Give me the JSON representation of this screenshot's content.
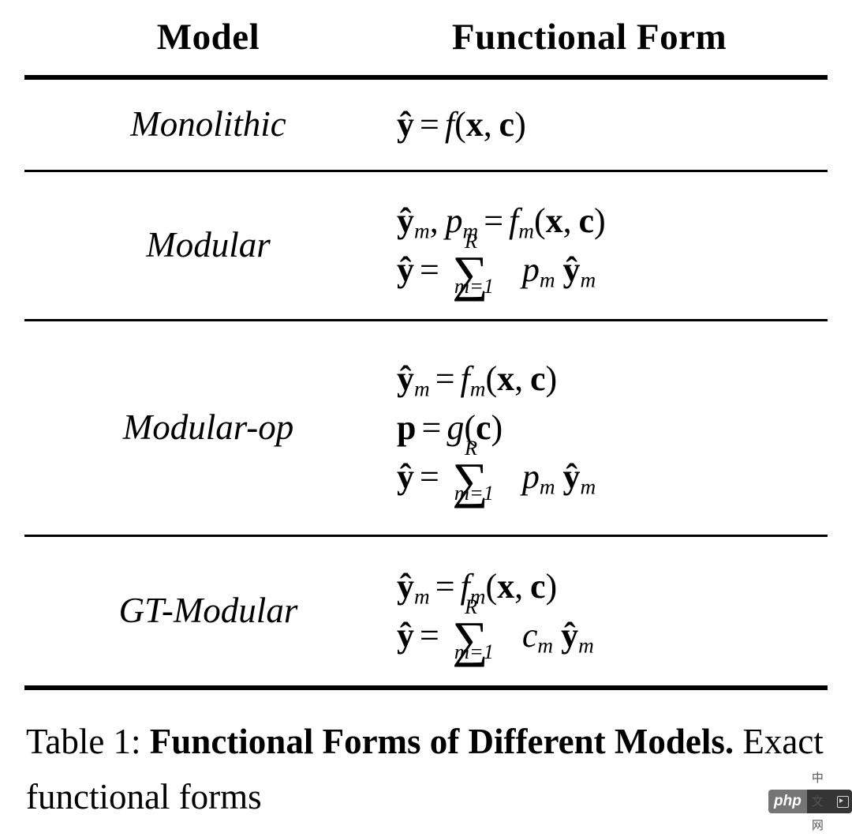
{
  "table": {
    "caption_number": "Table 1:",
    "caption_bold": "Functional Forms of Different Models.",
    "caption_rest": "Exact functional forms",
    "headers": {
      "model": "Model",
      "functional_form": "Functional Form"
    },
    "rows": [
      {
        "model": "Monolithic",
        "formula_lines": [
          "ŷ = f(x, c)"
        ]
      },
      {
        "model": "Modular",
        "formula_lines": [
          "ŷ_m, p_m = f_m(x, c)",
          "ŷ = Σ_{m=1}^{R} p_m ŷ_m"
        ]
      },
      {
        "model": "Modular-op",
        "formula_lines": [
          "ŷ_m = f_m(x, c)",
          "p = g(c)",
          "ŷ = Σ_{m=1}^{R} p_m ŷ_m"
        ]
      },
      {
        "model": "GT-Modular",
        "formula_lines": [
          "ŷ_m = f_m(x, c)",
          "ŷ = Σ_{m=1}^{R} c_m ŷ_m"
        ]
      }
    ],
    "symbols": {
      "y_hat": "ŷ",
      "equals": "=",
      "sum": "∑",
      "sum_upper": "R",
      "sum_lower": "m=1",
      "subscript_m": "m",
      "f": "f",
      "g": "g",
      "p": "p",
      "c": "c",
      "x": "x",
      "comma": ",",
      "open_paren": "(",
      "close_paren": ")"
    }
  },
  "watermark": {
    "php_label": "php",
    "cn_label": "中文网",
    "icon": "video-icon"
  },
  "colors": {
    "text": "#000000",
    "background": "#ffffff",
    "rule": "#000000",
    "watermark_php_bg": "#6e6e6e",
    "watermark_cn_bg": "#2b2b2b"
  }
}
